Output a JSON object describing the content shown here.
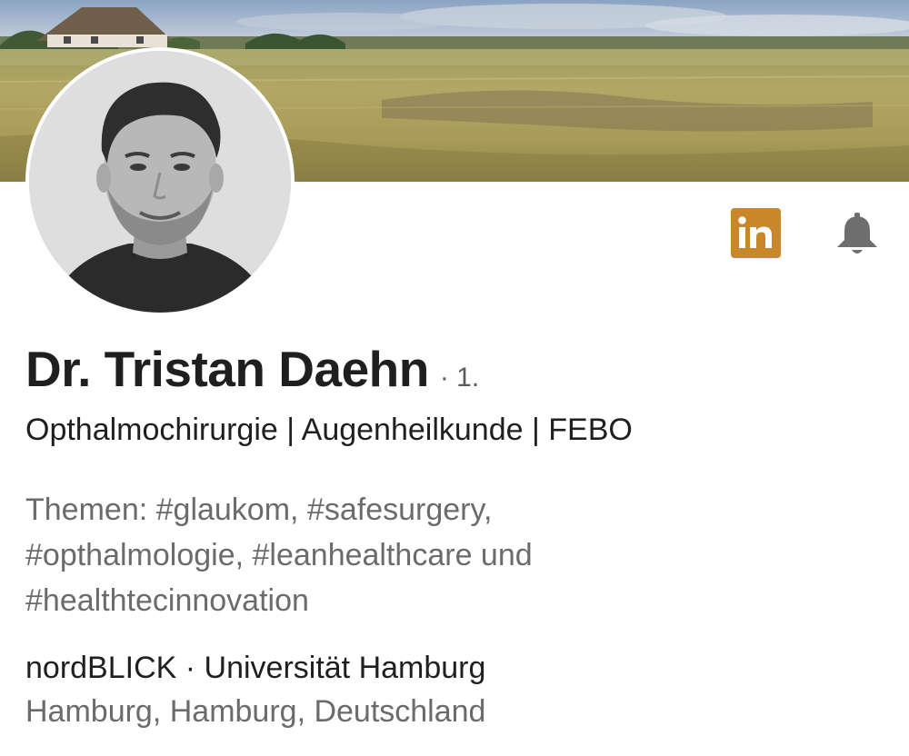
{
  "profile": {
    "name": "Dr. Tristan Daehn",
    "connection_degree": "· 1.",
    "headline": "Opthalmochirurgie | Augenheilkunde | FEBO",
    "topics_lines": [
      "Themen: #glaukom, #safesurgery,",
      "#opthalmologie, #leanhealthcare und",
      "#healthtecinnovation"
    ],
    "organizations": "nordBLICK · Universität Hamburg",
    "location": "Hamburg, Hamburg, Deutschland"
  },
  "actions": {
    "linkedin_label": "in",
    "linkedin_color": "#c8872a",
    "bell_icon": "bell-icon",
    "bell_color": "#6e6e6e"
  },
  "colors": {
    "primary_text": "#1f1f1f",
    "secondary_text": "#6b6b6b"
  }
}
